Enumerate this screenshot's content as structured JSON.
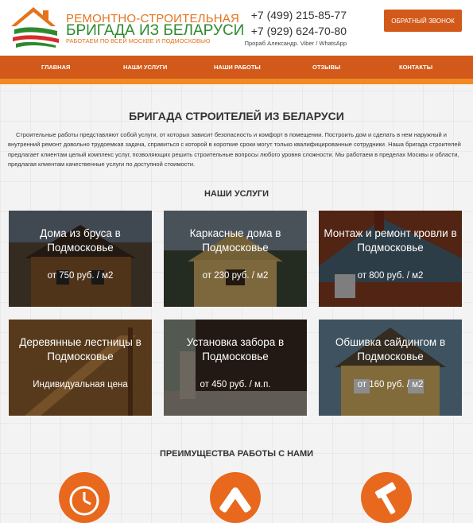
{
  "header": {
    "logo": {
      "line1": "РЕМОНТНО-СТРОИТЕЛЬНАЯ",
      "line2": "БРИГАДА ИЗ БЕЛАРУСИ",
      "line3": "РАБОТАЕМ ПО ВСЕЙ МОСКВЕ И ПОДМОСКОВЬЮ"
    },
    "phone1": "+7 (499) 215-85-77",
    "phone2": "+7 (929) 624-70-80",
    "contact_note": "Прораб Александр. Viber / WhatsApp",
    "callback_button": "ОБРАТНЫЙ ЗВОНОК"
  },
  "nav": {
    "items": [
      "ГЛАВНАЯ",
      "НАШИ УСЛУГИ",
      "НАШИ РАБОТЫ",
      "ОТЗЫВЫ",
      "КОНТАКТЫ"
    ]
  },
  "main": {
    "title": "БРИГАДА СТРОИТЕЛЕЙ ИЗ БЕЛАРУСИ",
    "intro": "Строительные работы представляют собой услуги, от которых зависит безопасность и комфорт в помещении. Построить дом и сделать в нем наружный и внутренний ремонт довольно трудоемкая задача, справиться с которой в короткие сроки могут только квалифицированные сотрудники. Наша бригада строителей предлагает клиентам целый комплекс услуг, позволяющих решить строительные вопросы любого уровня сложности. Мы работаем в пределах Москвы и области, предлагая клиентам качественные услуги по доступной стоимости."
  },
  "services": {
    "title": "НАШИ УСЛУГИ",
    "items": [
      {
        "title": "Дома из бруса в Подмосковье",
        "price": "от 750 руб. / м2"
      },
      {
        "title": "Каркасные дома в Подмосковье",
        "price": "от 230 руб. / м2"
      },
      {
        "title": "Монтаж и ремонт кровли в Подмосковье",
        "price": "от 800 руб. / м2"
      },
      {
        "title": "Деревянные лестницы в Подмосковье",
        "price": "Индивидуальная цена"
      },
      {
        "title": "Установка забора в Подмосковье",
        "price": "от 450 руб. / м.п."
      },
      {
        "title": "Обшивка сайдингом в Подмосковье",
        "price": "от 160 руб. / м2"
      }
    ]
  },
  "advantages": {
    "title": "ПРЕИМУЩЕСТВА РАБОТЫ С НАМИ",
    "icons": [
      "clock-icon",
      "tools-icon",
      "hammer-icon"
    ]
  },
  "colors": {
    "accent": "#d2591a",
    "accent_light": "#f08a23",
    "brand_green": "#2d8a2d"
  }
}
